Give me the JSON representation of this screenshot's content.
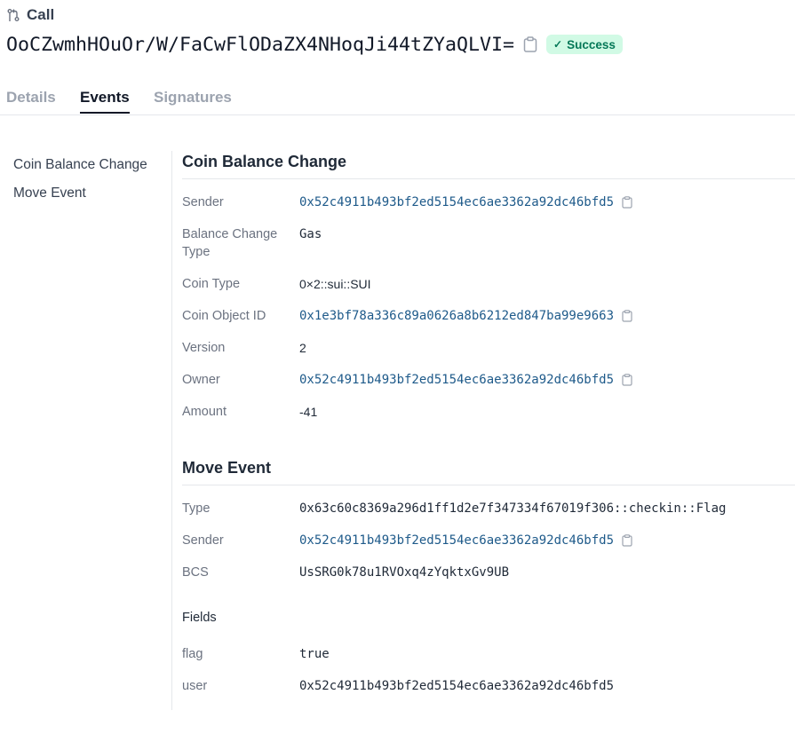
{
  "header": {
    "kind_label": "Call",
    "digest": "OoCZwmhHOuOr/W/FaCwFlODaZX4NHoqJi44tZYaQLVI=",
    "status": "Success"
  },
  "tabs": [
    {
      "label": "Details"
    },
    {
      "label": "Events"
    },
    {
      "label": "Signatures"
    }
  ],
  "side_nav": [
    {
      "label": "Coin Balance Change"
    },
    {
      "label": "Move Event"
    }
  ],
  "coin_balance": {
    "title": "Coin Balance Change",
    "sender_label": "Sender",
    "sender": "0x52c4911b493bf2ed5154ec6ae3362a92dc46bfd5",
    "balance_type_label": "Balance Change Type",
    "balance_type": "Gas",
    "coin_type_label": "Coin Type",
    "coin_type": "0×2::sui::SUI",
    "coin_object_label": "Coin Object ID",
    "coin_object": "0x1e3bf78a336c89a0626a8b6212ed847ba99e9663",
    "version_label": "Version",
    "version": "2",
    "owner_label": "Owner",
    "owner": "0x52c4911b493bf2ed5154ec6ae3362a92dc46bfd5",
    "amount_label": "Amount",
    "amount": "-41"
  },
  "move_event": {
    "title": "Move Event",
    "type_label": "Type",
    "type": "0x63c60c8369a296d1ff1d2e7f347334f67019f306::checkin::Flag",
    "sender_label": "Sender",
    "sender": "0x52c4911b493bf2ed5154ec6ae3362a92dc46bfd5",
    "bcs_label": "BCS",
    "bcs": "UsSRG0k78u1RVOxq4zYqktxGv9UB",
    "fields_title": "Fields",
    "flag_label": "flag",
    "flag": "true",
    "user_label": "user",
    "user": "0x52c4911b493bf2ed5154ec6ae3362a92dc46bfd5"
  },
  "colors": {
    "link": "#1e5a8a",
    "success_bg": "#d1fae5",
    "success_text": "#047857"
  }
}
